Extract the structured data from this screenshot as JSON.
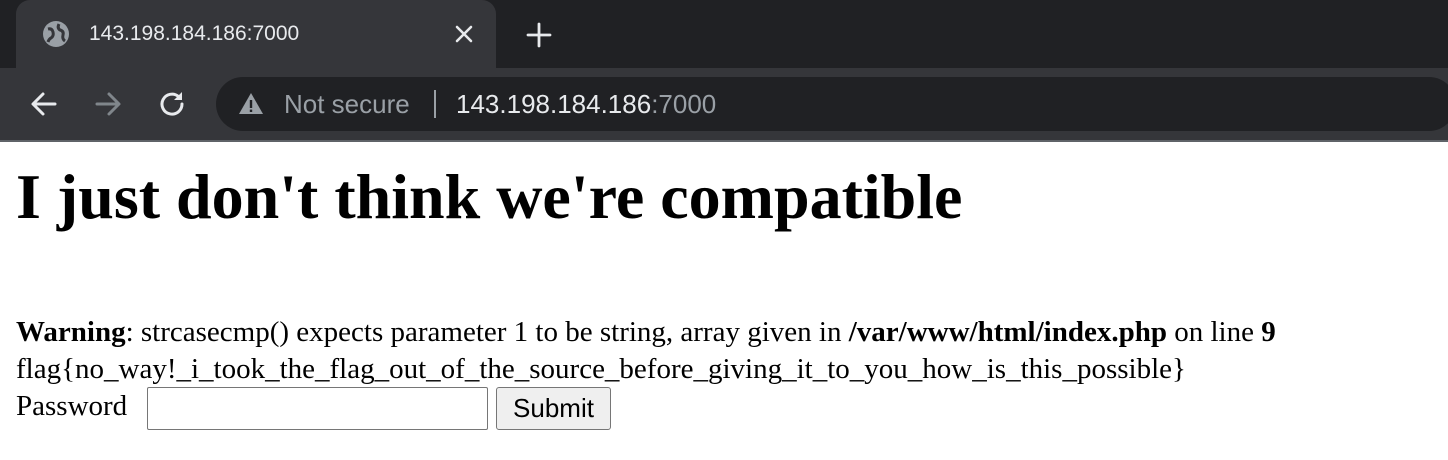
{
  "browser": {
    "tab": {
      "title": "143.198.184.186:7000",
      "favicon": "globe-icon"
    },
    "omnibox": {
      "security_label": "Not secure",
      "url_host": "143.198.184.186",
      "url_port": ":7000"
    },
    "icons": {
      "close": "close-icon",
      "new_tab": "plus-icon",
      "back": "back-arrow-icon",
      "forward": "forward-arrow-icon",
      "reload": "reload-icon",
      "warning": "warning-icon"
    }
  },
  "page": {
    "heading": "I just don't think we're compatible",
    "warning": {
      "label": "Warning",
      "message_part1": ": strcasecmp() expects parameter 1 to be string, array given in ",
      "path": "/var/www/html/index.php",
      "message_part2": " on line ",
      "line_number": "9"
    },
    "flag_text": "flag{no_way!_i_took_the_flag_out_of_the_source_before_giving_it_to_you_how_is_this_possible}",
    "form": {
      "password_label": "Password",
      "password_value": "",
      "submit_label": "Submit"
    }
  }
}
